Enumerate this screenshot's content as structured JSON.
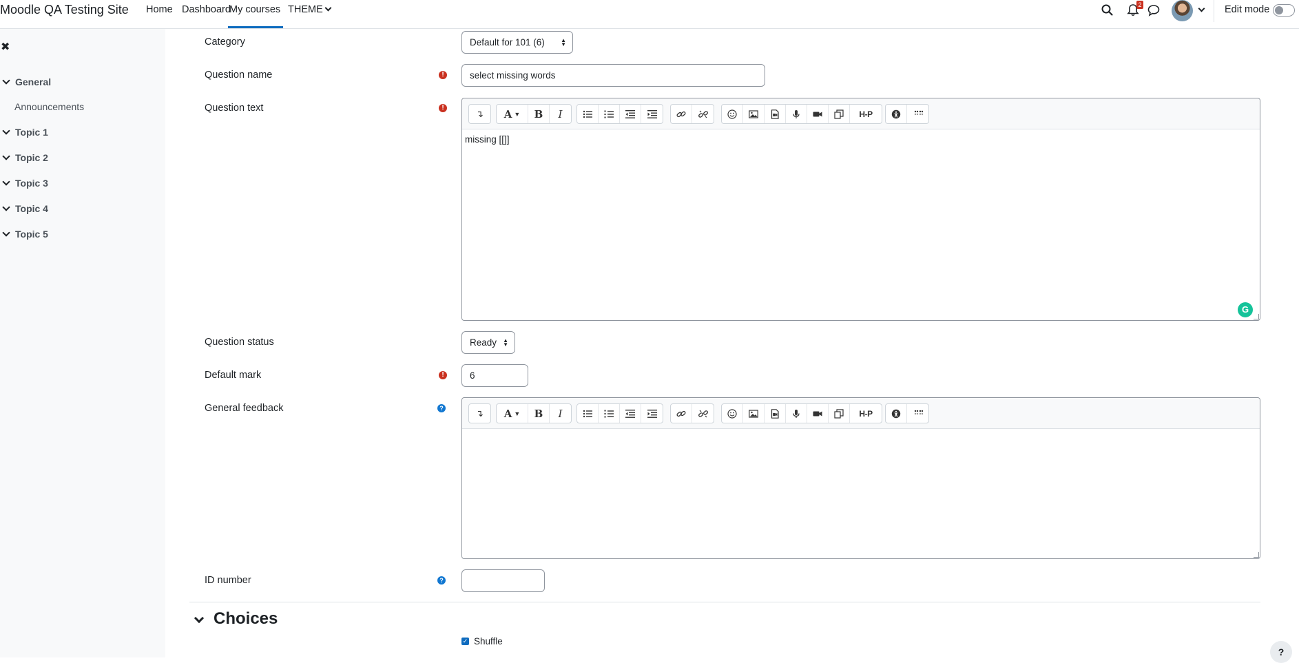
{
  "navbar": {
    "site_name": "Moodle QA Testing Site",
    "links": [
      "Home",
      "Dashboard",
      "My courses",
      "THEME"
    ],
    "active": "My courses",
    "notification_count": "2",
    "edit_mode_label": "Edit mode",
    "edit_mode_on": false
  },
  "course_index": {
    "close_icon": "✖",
    "sections": [
      {
        "label": "General",
        "children": [
          "Announcements"
        ]
      },
      {
        "label": "Topic 1"
      },
      {
        "label": "Topic 2"
      },
      {
        "label": "Topic 3"
      },
      {
        "label": "Topic 4"
      },
      {
        "label": "Topic 5"
      }
    ]
  },
  "form": {
    "category": {
      "label": "Category",
      "value": "Default for 101 (6)"
    },
    "question_name": {
      "label": "Question name",
      "value": "select missing words"
    },
    "question_text": {
      "label": "Question text",
      "content": "missing [[]]"
    },
    "question_status": {
      "label": "Question status",
      "value": "Ready"
    },
    "default_mark": {
      "label": "Default mark",
      "value": "6"
    },
    "general_feedback": {
      "label": "General feedback",
      "content": ""
    },
    "id_number": {
      "label": "ID number",
      "value": ""
    },
    "required_icon": "!",
    "help_icon": "?"
  },
  "choices": {
    "title": "Choices",
    "shuffle_label": "Shuffle",
    "shuffle_checked": true
  },
  "editor_toolbar_icons": [
    [
      "collapse-icon"
    ],
    [
      "font-style-icon",
      "bold-icon",
      "italic-icon"
    ],
    [
      "unordered-list-icon",
      "ordered-list-icon",
      "outdent-icon",
      "indent-icon"
    ],
    [
      "link-icon",
      "unlink-icon"
    ],
    [
      "emoji-icon",
      "image-icon",
      "media-icon",
      "record-audio-icon",
      "record-video-icon",
      "manage-files-icon",
      "h5p-icon"
    ],
    [
      "accessibility-checker-icon",
      "screenreader-helper-icon"
    ]
  ],
  "editor_tool_glyphs": {
    "collapse": "↴",
    "bold": "B",
    "italic": "I",
    "h5p": "H-P",
    "font": "A"
  },
  "floating_help": "?",
  "colors": {
    "primary": "#0f6cbf",
    "danger": "#ca3120",
    "info": "#1177d1",
    "grammarly": "#15c39a"
  }
}
